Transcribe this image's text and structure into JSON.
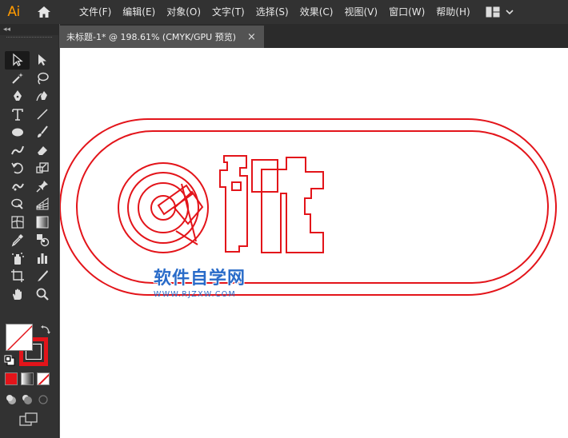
{
  "app": {
    "logo": "Ai",
    "accent": "#ff9a00"
  },
  "menu": {
    "items": [
      "文件(F)",
      "编辑(E)",
      "对象(O)",
      "文字(T)",
      "选择(S)",
      "效果(C)",
      "视图(V)",
      "窗口(W)",
      "帮助(H)"
    ]
  },
  "document": {
    "tab_title": "未标题-1* @ 198.61% (CMYK/GPU 预览)",
    "close_label": "×"
  },
  "toolbar": {
    "collapse_label": "◂◂",
    "tools": [
      [
        "selection-icon",
        "direct-selection-icon"
      ],
      [
        "magic-wand-icon",
        "lasso-icon"
      ],
      [
        "pen-icon",
        "curvature-icon"
      ],
      [
        "type-icon",
        "line-segment-icon"
      ],
      [
        "ellipse-icon",
        "paintbrush-icon"
      ],
      [
        "shaper-icon",
        "eraser-icon"
      ],
      [
        "rotate-icon",
        "scale-icon"
      ],
      [
        "puppet-warp-icon",
        "pin-icon"
      ],
      [
        "free-transform-icon",
        "perspective-grid-icon"
      ],
      [
        "mesh-icon",
        "gradient-icon"
      ],
      [
        "eyedropper-icon",
        "blend-icon"
      ],
      [
        "symbol-sprayer-icon",
        "column-graph-icon"
      ],
      [
        "artboard-icon",
        "slice-icon"
      ],
      [
        "hand-icon",
        "zoom-icon"
      ]
    ]
  },
  "colors": {
    "fill": "#ffffff",
    "stroke": "#e3141a"
  },
  "artwork": {
    "stroke_color": "#e3141a"
  },
  "watermark": {
    "title": "软件自学网",
    "url": "WWW.RJZXW.COM",
    "color": "#2a6cc9"
  }
}
